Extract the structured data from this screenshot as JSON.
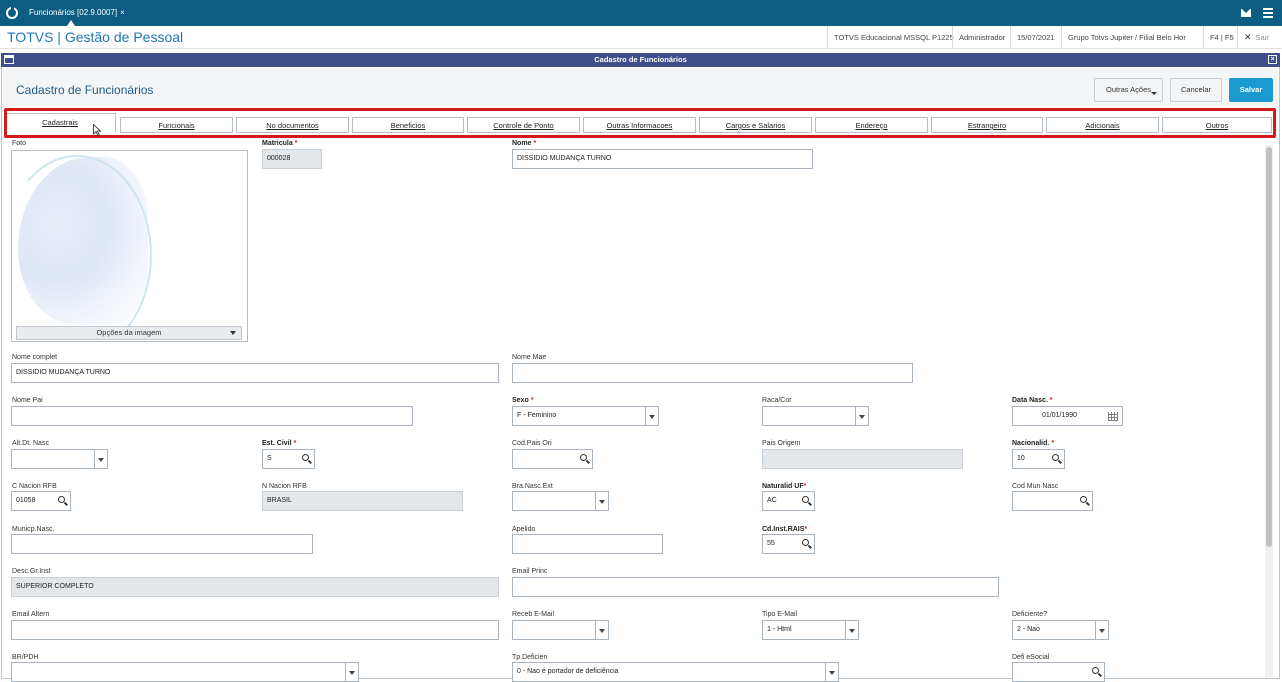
{
  "appbar": {
    "tab_label": "Funcionários [02.9.0007]",
    "tab_close": "×"
  },
  "header": {
    "brand": "TOTVS | Gestão de Pessoal",
    "environment": "TOTVS Educacional MSSQL P1225",
    "user": "Administrador",
    "date": "15/07/2021",
    "company": "Grupo Totvs Jupiter / Filial Belo Hor",
    "shortcuts": "F4 | F5",
    "exit": "Sair"
  },
  "window": {
    "title": "Cadastro de Funcionários",
    "close": "×"
  },
  "page": {
    "title": "Cadastro de Funcionários"
  },
  "actions": {
    "more": "Outras Ações",
    "cancel": "Cancelar",
    "save": "Salvar"
  },
  "tabs": [
    "Cadastrais",
    "Funcionais",
    "No documentos",
    "Beneficios",
    "Controle de Ponto",
    "Outras Informacoes",
    "Cargos e Salarios",
    "Endereço",
    "Estrangeiro",
    "Adicionais",
    "Outros"
  ],
  "photo": {
    "label": "Foto",
    "options": "Opções da imagem"
  },
  "fields": {
    "matricula": {
      "label": "Matricula",
      "value": "000028"
    },
    "nome": {
      "label": "Nome",
      "value": "DISSIDIO MUDANÇA TURNO"
    },
    "nome_complet": {
      "label": "Nome complet",
      "value": "DISSIDIO MUDANÇA TURNO"
    },
    "nome_mae": {
      "label": "Nome Mae",
      "value": ""
    },
    "nome_pai": {
      "label": "Nome Pai",
      "value": ""
    },
    "sexo": {
      "label": "Sexo",
      "value": "F - Feminino"
    },
    "raca_cor": {
      "label": "Raca/Cor",
      "value": ""
    },
    "data_nasc": {
      "label": "Data Nasc.",
      "value": "01/01/1990"
    },
    "alt_dt_nasc": {
      "label": "Alt.Dt. Nasc",
      "value": ""
    },
    "est_civil": {
      "label": "Est. Civil",
      "value": "S"
    },
    "cod_pais_ori": {
      "label": "Cod.Pais Ori",
      "value": ""
    },
    "pais_origem": {
      "label": "Pais Origem",
      "value": ""
    },
    "nacionalid": {
      "label": "Nacionalid.",
      "value": "10"
    },
    "c_nacion_rfb": {
      "label": "C Nacion RFB",
      "value": "01058"
    },
    "n_nacion_rfb": {
      "label": "N Nacion RFB",
      "value": "BRASIL"
    },
    "bra_nasc_ext": {
      "label": "Bra.Nasc.Ext",
      "value": ""
    },
    "naturalid_uf": {
      "label": "Naturalid UF",
      "value": "AC"
    },
    "cod_mun_nasc": {
      "label": "Cod Mun Nasc",
      "value": ""
    },
    "municp_nasc": {
      "label": "Municp.Nasc.",
      "value": ""
    },
    "apelido": {
      "label": "Apelido",
      "value": ""
    },
    "cd_inst_rais": {
      "label": "Cd.Inst.RAIS",
      "value": "55"
    },
    "desc_gr_inst": {
      "label": "Desc.Gr.Inst",
      "value": "SUPERIOR COMPLETO"
    },
    "email_princ": {
      "label": "Email Princ",
      "value": ""
    },
    "email_altern": {
      "label": "Email Altern",
      "value": ""
    },
    "receb_email": {
      "label": "Receb E-Mail",
      "value": ""
    },
    "tipo_email": {
      "label": "Tipo E-Mail",
      "value": "1 - Html"
    },
    "deficiente": {
      "label": "Deficiente?",
      "value": "2 - Nao"
    },
    "br_pdh": {
      "label": "BR/PDH",
      "value": ""
    },
    "tp_deficien": {
      "label": "Tp.Deficien",
      "value": "0 - Nao é portador de deficiência"
    },
    "defi_esocial": {
      "label": "Defi eSocial",
      "value": ""
    }
  },
  "required_mark": "*"
}
